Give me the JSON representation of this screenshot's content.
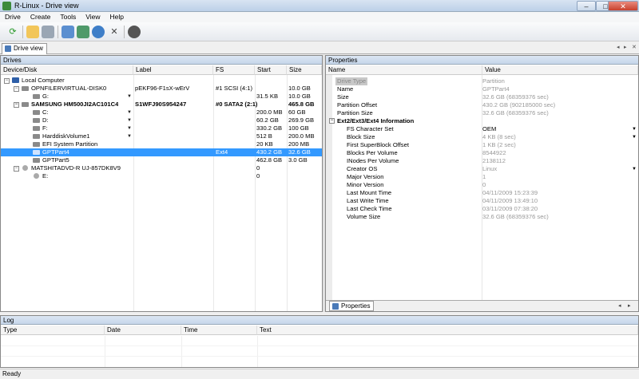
{
  "window": {
    "title": "R-Linux - Drive view",
    "min": "–",
    "max": "□",
    "close": "✕"
  },
  "menu": [
    "Drive",
    "Create",
    "Tools",
    "View",
    "Help"
  ],
  "toolbar": {
    "buttons": [
      "refresh-icon",
      "open-image-icon",
      "scan-icon",
      "recover-icon",
      "recover-marked-icon",
      "network-icon",
      "remove-icon",
      "stop-icon"
    ]
  },
  "tab": {
    "label": "Drive view",
    "nav_left": "◂",
    "nav_right": "▸",
    "close": "✕"
  },
  "drives": {
    "title": "Drives",
    "columns": [
      "Device/Disk",
      "Label",
      "FS",
      "Start",
      "Size"
    ],
    "rows": [
      {
        "name": "Local Computer",
        "label": "",
        "fs": "",
        "start": "",
        "size": ""
      },
      {
        "name": "OPNFILERVIRTUAL-DISK0",
        "label": "pEKF96-F1sX-wErV",
        "fs": "#1  SCSI (4:1)",
        "start": "",
        "size": "10.0 GB"
      },
      {
        "name": "G:",
        "label": "",
        "fs": "",
        "start": "31.5 KB",
        "size": "10.0 GB"
      },
      {
        "name": "SAMSUNG HM500JI2AC101C4",
        "label": "S1WFJ90S954247",
        "fs": "#0  SATA2 (2:1)",
        "start": "",
        "size": "465.8 GB"
      },
      {
        "name": "C:",
        "label": "",
        "fs": "",
        "start": "200.0 MB",
        "size": "60 GB"
      },
      {
        "name": "D:",
        "label": "",
        "fs": "",
        "start": "60.2 GB",
        "size": "269.9 GB"
      },
      {
        "name": "F:",
        "label": "",
        "fs": "",
        "start": "330.2 GB",
        "size": "100 GB"
      },
      {
        "name": "HarddiskVolume1",
        "label": "",
        "fs": "",
        "start": "512 B",
        "size": "200.0 MB"
      },
      {
        "name": "EFI System Partition",
        "label": "",
        "fs": "",
        "start": "20 KB",
        "size": "200 MB"
      },
      {
        "name": "GPTPart4",
        "label": "",
        "fs": "Ext4",
        "start": "430.2 GB",
        "size": "32.6 GB"
      },
      {
        "name": "GPTPart5",
        "label": "",
        "fs": "",
        "start": "462.8 GB",
        "size": "3.0 GB"
      },
      {
        "name": "MATSHITADVD-R UJ-857DK8V9",
        "label": "",
        "fs": "",
        "start": "0",
        "size": ""
      },
      {
        "name": "E:",
        "label": "",
        "fs": "",
        "start": "0",
        "size": ""
      }
    ]
  },
  "properties": {
    "title": "Properties",
    "columns": [
      "Name",
      "Value"
    ],
    "tab_label": "Properties",
    "rows": [
      {
        "name": "Drive Type",
        "value": "Partition"
      },
      {
        "name": "Name",
        "value": "GPTPart4"
      },
      {
        "name": "Size",
        "value": "32.6 GB (68359376 sec)"
      },
      {
        "name": "Partition Offset",
        "value": "430.2 GB (902185000 sec)"
      },
      {
        "name": "Partition Size",
        "value": "32.6 GB (68359376 sec)"
      },
      {
        "name": "Ext2/Ext3/Ext4 Information",
        "value": ""
      },
      {
        "name": "FS Character Set",
        "value": "OEM"
      },
      {
        "name": "Block Size",
        "value": "4 KB (8 sec)"
      },
      {
        "name": "First SuperBlock Offset",
        "value": "1 KB (2 sec)"
      },
      {
        "name": "Blocks Per Volume",
        "value": "8544922"
      },
      {
        "name": "INodes Per Volume",
        "value": "2138112"
      },
      {
        "name": "Creator OS",
        "value": "Linux"
      },
      {
        "name": "Major Version",
        "value": "1"
      },
      {
        "name": "Minor Version",
        "value": "0"
      },
      {
        "name": "Last Mount Time",
        "value": "04/11/2009 15:23:39"
      },
      {
        "name": "Last Write Time",
        "value": "04/11/2009 13:49:10"
      },
      {
        "name": "Last Check Time",
        "value": "03/11/2009 07:38:20"
      },
      {
        "name": "Volume Size",
        "value": "32.6 GB (68359376 sec)"
      }
    ]
  },
  "log": {
    "title": "Log",
    "columns": [
      "Type",
      "Date",
      "Time",
      "Text"
    ]
  },
  "status": {
    "text": "Ready"
  },
  "colors": {
    "selection": "#3399ff",
    "panel_header": "#c6d6ea"
  }
}
